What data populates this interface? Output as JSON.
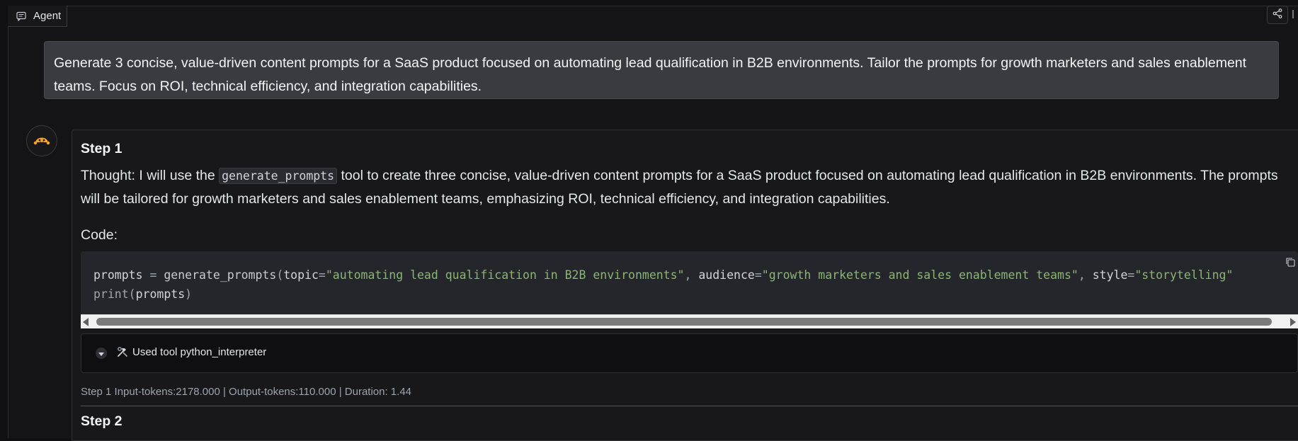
{
  "tab": {
    "label": "Agent"
  },
  "user_message": {
    "text": "Generate 3 concise, value-driven content prompts for a SaaS product focused on automating lead qualification in B2B environments. Tailor the prompts for growth marketers and sales enablement teams. Focus on ROI, technical efficiency, and integration capabilities."
  },
  "step1": {
    "title": "Step 1",
    "thought_prefix": "Thought: I will use the ",
    "thought_tool": "generate_prompts",
    "thought_suffix": " tool to create three concise, value-driven content prompts for a SaaS product focused on automating lead qualification in B2B environments. The prompts will be tailored for growth marketers and sales enablement teams, emphasizing ROI, technical efficiency, and integration capabilities.",
    "code_label": "Code:",
    "code": {
      "line1": {
        "var": "prompts",
        "eq": " = ",
        "fn": "generate_prompts",
        "open": "(",
        "arg1_name": "topic",
        "arg1_eq": "=",
        "arg1_val": "\"automating lead qualification in B2B environments\"",
        "sep1": ", ",
        "arg2_name": "audience",
        "arg2_eq": "=",
        "arg2_val": "\"growth marketers and sales enablement teams\"",
        "sep2": ", ",
        "arg3_name": "style",
        "arg3_eq": "=",
        "arg3_val": "\"storytelling\""
      },
      "line2": {
        "fn": "print",
        "open": "(",
        "arg": "prompts",
        "close": ")"
      }
    },
    "tool_used": "Used tool python_interpreter",
    "meta": "Step 1 Input-tokens:2178.000 | Output-tokens:110.000 | Duration: 1.44"
  },
  "step2": {
    "title": "Step 2"
  },
  "icons": {
    "tab": "chat-icon",
    "share": "share-icon",
    "avatar": "agent-avatar-icon",
    "copy": "copy-icon",
    "tool": "hammer-wrench-icon",
    "toggle": "chevron-down-icon"
  },
  "colors": {
    "background": "#111113",
    "user_bubble": "#3a3b40",
    "code_bg": "#25262b",
    "string": "#8bb574",
    "avatar_accent": "#f5a623"
  }
}
